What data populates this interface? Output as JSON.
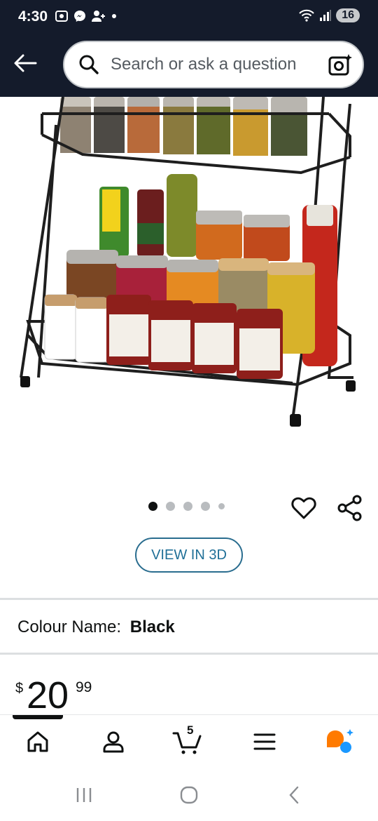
{
  "status_bar": {
    "time": "4:30",
    "battery": "16",
    "notification_icons": [
      "screenshot-icon",
      "messenger-icon",
      "person-add-icon",
      "dot-icon"
    ],
    "system_icons": [
      "wifi-icon",
      "signal-icon"
    ]
  },
  "header": {
    "search_placeholder": "Search or ask a question"
  },
  "product": {
    "image_alt": "Black two-tier spice rack with jars and bottles",
    "image_count": 5,
    "active_image_index": 0
  },
  "view_3d_label": "VIEW IN 3D",
  "colour": {
    "label": "Colour Name:",
    "value": "Black"
  },
  "price": {
    "symbol": "$",
    "whole": "20",
    "fraction": "99"
  },
  "bottom_nav": {
    "cart_count": "5",
    "items": [
      "home-icon",
      "account-icon",
      "cart-icon",
      "menu-icon",
      "rufus-assistant-icon"
    ],
    "active_index": 0
  },
  "colors": {
    "header_bg": "#141b2b",
    "accent_blue": "#1f6f97",
    "assistant_orange": "#ff7a00",
    "assistant_blue": "#1a98ff"
  }
}
